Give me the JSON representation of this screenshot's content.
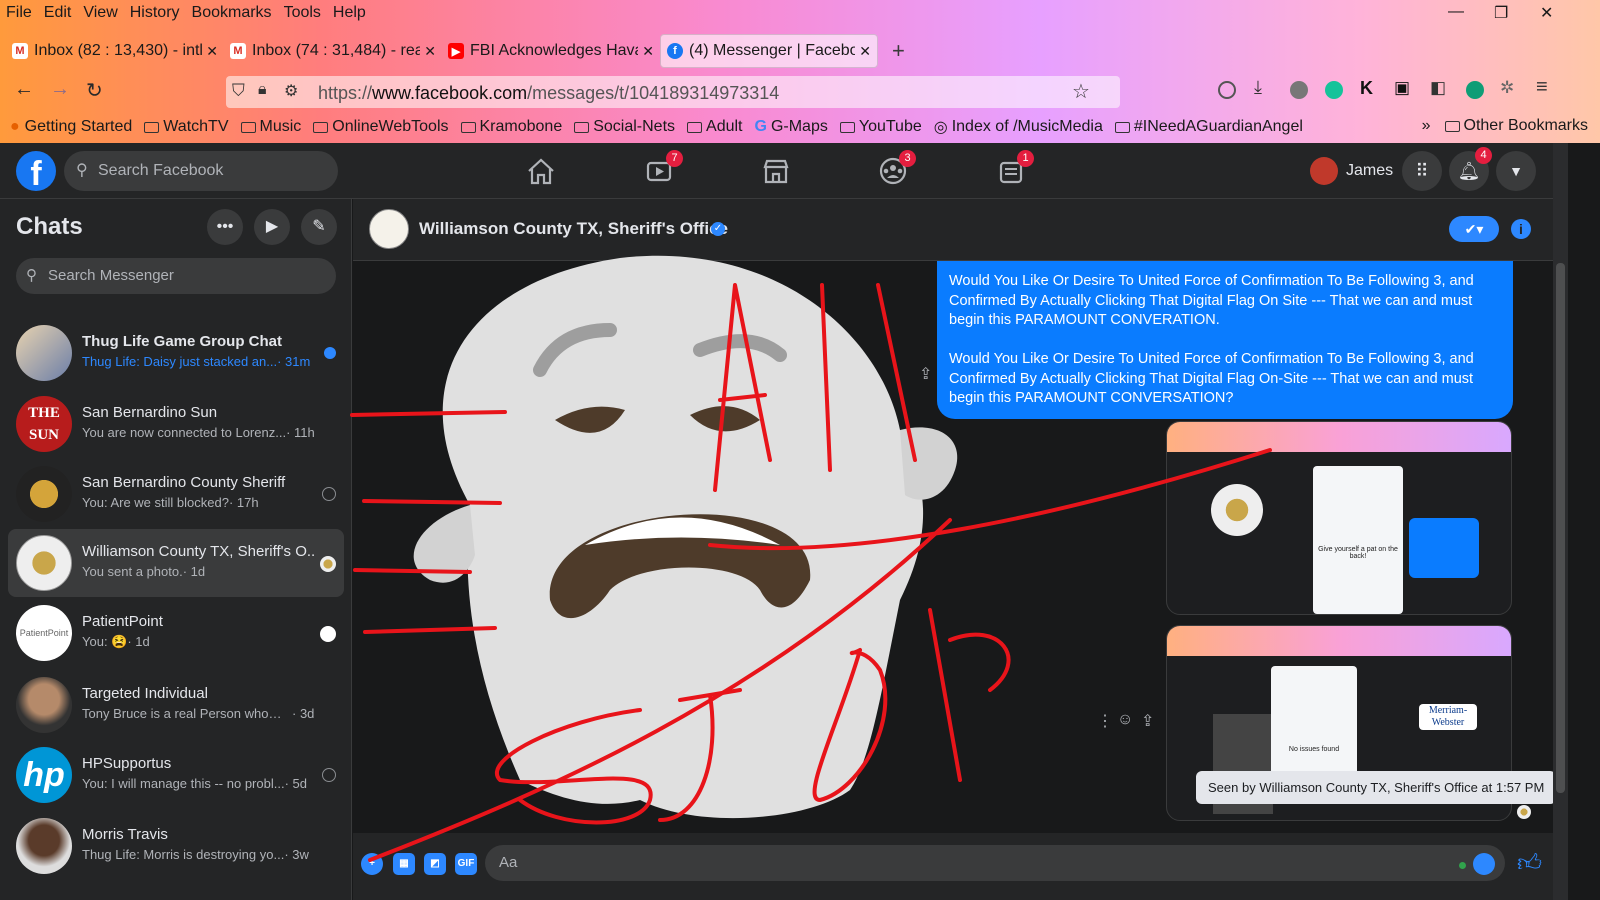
{
  "browser": {
    "menu": [
      "File",
      "Edit",
      "View",
      "History",
      "Bookmarks",
      "Tools",
      "Help"
    ],
    "tabs": [
      {
        "label": "Inbox (82 : 13,430) - intl",
        "icon": "gmail-icon",
        "color": "#d93025"
      },
      {
        "label": "Inbox (74 : 31,484) - rea",
        "icon": "gmail-icon",
        "color": "#d93025"
      },
      {
        "label": "FBI Acknowledges Hava",
        "icon": "youtube-icon",
        "color": "#ff0000"
      },
      {
        "label": "(4) Messenger | Facebook",
        "icon": "facebook-icon",
        "color": "#1877f2"
      }
    ],
    "url_prefix": "https://",
    "url_domain": "www.facebook.com",
    "url_path": "/messages/t/104189314973314",
    "bookmarks": [
      "Getting Started",
      "WatchTV",
      "Music",
      "OnlineWebTools",
      "Kramobone",
      "Social-Nets",
      "Adult",
      "G-Maps",
      "YouTube",
      "Index of /MusicMedia",
      "#INeedAGuardianAngel"
    ],
    "other_bookmarks": "Other Bookmarks"
  },
  "facebook": {
    "search_placeholder": "Search Facebook",
    "badges": {
      "watch": "7",
      "groups": "3",
      "gaming": "1",
      "notifications": "4"
    },
    "user_name": "James"
  },
  "chats": {
    "title": "Chats",
    "search_placeholder": "Search Messenger",
    "items": [
      {
        "name": "Thug Life Game Group Chat",
        "preview": "Thug Life: Daisy just stacked an...",
        "time": " · 31m",
        "unread": true
      },
      {
        "name": "San Bernardino Sun",
        "preview": "You are now connected to Lorenz...",
        "time": " · 11h",
        "unread": false
      },
      {
        "name": "San Bernardino County Sheriff",
        "preview": "You: Are we still blocked?",
        "time": " · 17h",
        "unread": false
      },
      {
        "name": "Williamson County TX, Sheriff's O...",
        "preview": "You sent a photo.",
        "time": " · 1d",
        "unread": false
      },
      {
        "name": "PatientPoint",
        "preview": "You: 😫",
        "time": " · 1d",
        "unread": false
      },
      {
        "name": "Targeted Individual",
        "preview": "Tony Bruce is a real Person whom ...",
        "time": " · 3d",
        "unread": false
      },
      {
        "name": "HPSupportus",
        "preview": "You: I will manage this -- no probl...",
        "time": " · 5d",
        "unread": false
      },
      {
        "name": "Morris Travis",
        "preview": "Thug Life: Morris is destroying yo...",
        "time": " · 3w",
        "unread": false
      }
    ]
  },
  "conversation": {
    "name": "Williamson County TX, Sheriff's Office",
    "message_p1": "Would You Like Or Desire To United Force of Confirmation To Be Following 3, and Confirmed By Actually Clicking That Digital Flag On Site --- That we can and must begin this PARAMOUNT CONVERATION.",
    "message_p2": "Would You Like Or Desire To United Force of Confirmation To Be Following 3, and Confirmed By Actually Clicking That Digital Flag On-Site --- That we can and must begin this PARAMOUNT CONVERSATION?",
    "seen": "Seen by Williamson County TX, Sheriff's Office at 1:57 PM",
    "composer_placeholder": "Aa",
    "shot1_caption": "Give yourself a pat on the back!",
    "shot2_caption": "No issues found",
    "shot2_logo": "Merriam-Webster"
  },
  "drawing": {
    "scribble_text_1": "ALL",
    "scribble_text_2": "STOP",
    "scribble_color": "#e8141a"
  }
}
